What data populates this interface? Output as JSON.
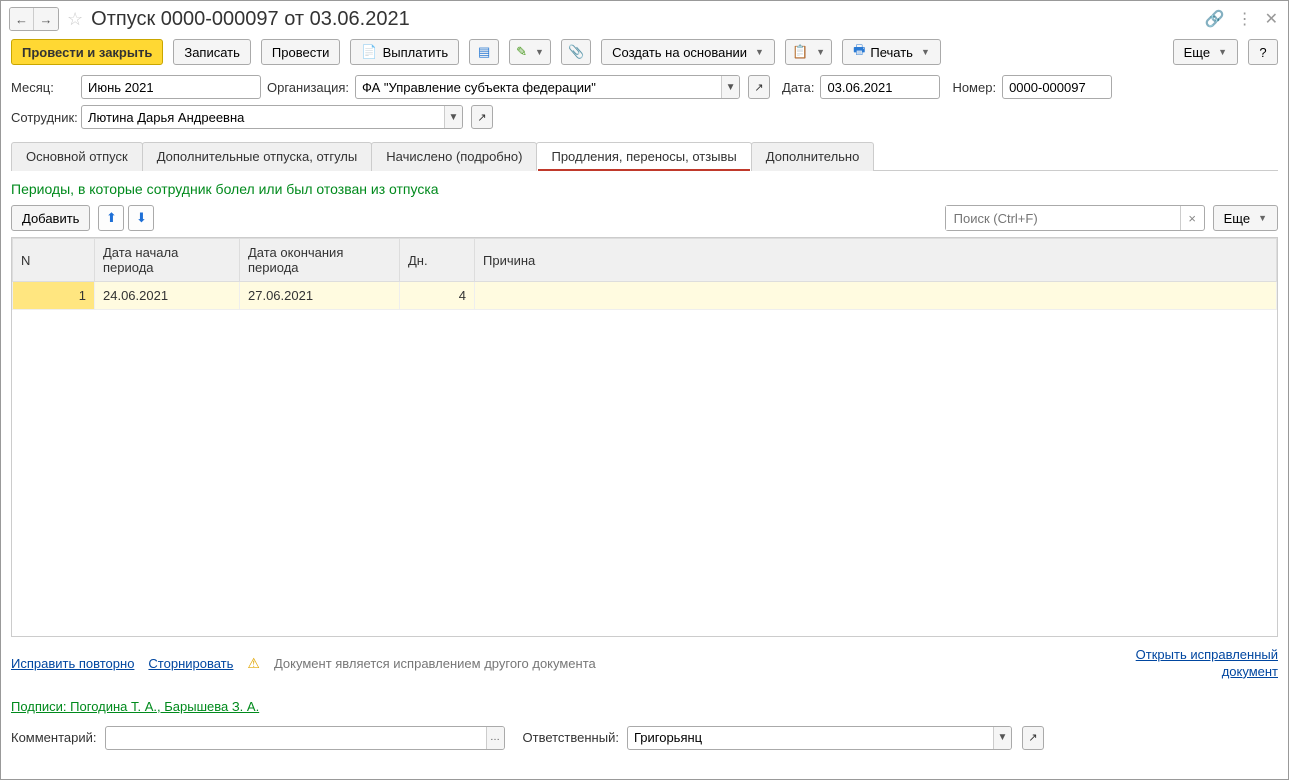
{
  "title": "Отпуск 0000-000097 от 03.06.2021",
  "toolbar": {
    "post_close": "Провести и закрыть",
    "save": "Записать",
    "post": "Провести",
    "pay": "Выплатить",
    "create_based": "Создать на основании",
    "print": "Печать",
    "more": "Еще",
    "help": "?"
  },
  "form": {
    "month_label": "Месяц:",
    "month_value": "Июнь 2021",
    "org_label": "Организация:",
    "org_value": "ФА \"Управление субъекта федерации\"",
    "date_label": "Дата:",
    "date_value": "03.06.2021",
    "number_label": "Номер:",
    "number_value": "0000-000097",
    "employee_label": "Сотрудник:",
    "employee_value": "Лютина Дарья Андреевна"
  },
  "tabs": {
    "t0": "Основной отпуск",
    "t1": "Дополнительные отпуска, отгулы",
    "t2": "Начислено (подробно)",
    "t3": "Продления, переносы, отзывы",
    "t4": "Дополнительно"
  },
  "section_heading": "Периоды, в которые сотрудник болел или был отозван из отпуска",
  "content_toolbar": {
    "add": "Добавить",
    "search_placeholder": "Поиск (Ctrl+F)",
    "more": "Еще"
  },
  "table": {
    "headers": {
      "n": "N",
      "start": "Дата начала периода",
      "end": "Дата окончания периода",
      "days": "Дн.",
      "reason": "Причина"
    },
    "rows": [
      {
        "n": "1",
        "start": "24.06.2021",
        "end": "27.06.2021",
        "days": "4",
        "reason": ""
      }
    ]
  },
  "links": {
    "fix_again": "Исправить повторно",
    "storno": "Сторнировать",
    "warn": "Документ является исправлением другого документа",
    "open_original": "Открыть исправленный документ",
    "signatures": "Подписи: Погодина Т. А., Барышева З. А."
  },
  "footer": {
    "comment_label": "Комментарий:",
    "comment_value": "",
    "responsible_label": "Ответственный:",
    "responsible_value": "Григорьянц"
  }
}
